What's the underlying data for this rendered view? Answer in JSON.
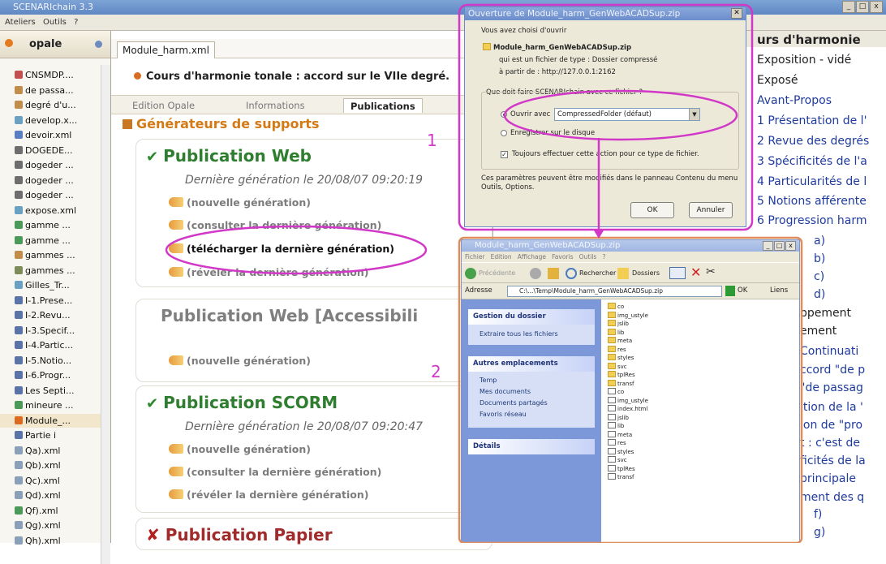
{
  "app": {
    "title": "SCENARIchain 3.3",
    "window_buttons": [
      "_",
      "□",
      "x"
    ]
  },
  "menubar": {
    "items": [
      "Ateliers",
      "Outils",
      "?"
    ]
  },
  "left_panel": {
    "header": "opale",
    "items": [
      {
        "label": "CNSMDP....",
        "color": "#c25050"
      },
      {
        "label": "de passa...",
        "color": "#c28c4a"
      },
      {
        "label": "degré d'u...",
        "color": "#c28c4a"
      },
      {
        "label": "develop.x...",
        "color": "#6aa0c2"
      },
      {
        "label": "devoir.xml",
        "color": "#5a7ec2"
      },
      {
        "label": "DOGEDE...",
        "color": "#6d6d6d"
      },
      {
        "label": "dogeder ...",
        "color": "#6d6d6d"
      },
      {
        "label": "dogeder ...",
        "color": "#6d6d6d"
      },
      {
        "label": "dogeder ...",
        "color": "#6d6d6d"
      },
      {
        "label": "expose.xml",
        "color": "#6aa0c2"
      },
      {
        "label": "gamme ...",
        "color": "#4c9a5a"
      },
      {
        "label": "gamme ...",
        "color": "#4c9a5a"
      },
      {
        "label": "gammes ...",
        "color": "#c28c4a"
      },
      {
        "label": "gammes ...",
        "color": "#7d8c5a"
      },
      {
        "label": "Gilles_Tr...",
        "color": "#6aa0c2"
      },
      {
        "label": "I-1.Prese...",
        "color": "#5a74a8"
      },
      {
        "label": "I-2.Revu...",
        "color": "#5a74a8"
      },
      {
        "label": "I-3.Specif...",
        "color": "#5a74a8"
      },
      {
        "label": "I-4.Partic...",
        "color": "#5a74a8"
      },
      {
        "label": "I-5.Notio...",
        "color": "#5a74a8"
      },
      {
        "label": "I-6.Progr...",
        "color": "#5a74a8"
      },
      {
        "label": "Les Septi...",
        "color": "#5a74a8"
      },
      {
        "label": "mineure ...",
        "color": "#4c9a5a"
      },
      {
        "label": "Module_...",
        "color": "#d96c20",
        "selected": true
      },
      {
        "label": "Partie i",
        "color": "#5a74a8"
      },
      {
        "label": "Qa).xml",
        "color": "#8aa0b8"
      },
      {
        "label": "Qb).xml",
        "color": "#8aa0b8"
      },
      {
        "label": "Qc).xml",
        "color": "#8aa0b8"
      },
      {
        "label": "Qd).xml",
        "color": "#8aa0b8"
      },
      {
        "label": "Qf).xml",
        "color": "#4c9a5a"
      },
      {
        "label": "Qg).xml",
        "color": "#8aa0b8"
      },
      {
        "label": "Qh).xml",
        "color": "#8aa0b8"
      }
    ]
  },
  "main": {
    "file_tab": "Module_harm.xml",
    "doc_title": "Cours d'harmonie tonale : accord sur le VIIe degré.",
    "tabs": [
      "Edition Opale",
      "Informations",
      "Publications"
    ],
    "section_title": "Générateurs de supports",
    "publications": [
      {
        "title": "Publication Web",
        "status": "ok",
        "last_gen": "Dernière génération le 20/08/07 09:20:19",
        "actions": [
          "(nouvelle génération)",
          "(consulter la dernière génération)",
          "(télécharger la dernière génération)",
          "(révéler la dernière génération)"
        ]
      },
      {
        "title": "Publication Web [Accessibili",
        "status": "none",
        "last_gen": "",
        "actions": [
          "(nouvelle génération)"
        ]
      },
      {
        "title": "Publication SCORM",
        "status": "ok",
        "last_gen": "Dernière génération le 20/08/07 09:20:47",
        "actions": [
          "(nouvelle génération)",
          "(consulter la dernière génération)",
          "(révéler la dernière génération)"
        ]
      },
      {
        "title": "Publication Papier",
        "status": "error",
        "last_gen": "",
        "actions": []
      }
    ]
  },
  "right_panel": {
    "lines": [
      {
        "text": "urs d'harmonie",
        "style": "bold"
      },
      {
        "text": "Exposition - vidé",
        "style": "normal"
      },
      {
        "text": "Exposé",
        "style": "normal"
      },
      {
        "text": "Avant-Propos",
        "style": "blue"
      },
      {
        "text": "1 Présentation de l'",
        "style": "blue"
      },
      {
        "text": "2 Revue des degrés",
        "style": "blue"
      },
      {
        "text": "3 Spécificités de l'a",
        "style": "blue"
      },
      {
        "text": "4 Particularités de l",
        "style": "blue"
      },
      {
        "text": "5 Notions afférente",
        "style": "blue"
      },
      {
        "text": "6 Progression harm",
        "style": "blue"
      },
      {
        "text": "a)",
        "style": "blue"
      },
      {
        "text": "b)",
        "style": "blue"
      },
      {
        "text": "c)",
        "style": "blue"
      },
      {
        "text": "d)",
        "style": "blue"
      },
      {
        "text": "ppement",
        "style": "normal"
      },
      {
        "text": "ement",
        "style": "normal"
      },
      {
        "text": "Continuati",
        "style": "blue"
      },
      {
        "text": "ccord \"de p",
        "style": "blue"
      },
      {
        "text": "\"de passag",
        "style": "blue"
      },
      {
        "text": "ition de la '",
        "style": "blue"
      },
      {
        "text": "ion de \"pro",
        "style": "blue"
      },
      {
        "text": "t : c'est de",
        "style": "blue"
      },
      {
        "text": "ficités de la",
        "style": "blue"
      },
      {
        "text": "principale",
        "style": "blue"
      },
      {
        "text": "ment des q",
        "style": "blue"
      },
      {
        "text": "f)",
        "style": "blue"
      },
      {
        "text": "g)",
        "style": "blue"
      }
    ]
  },
  "dialog": {
    "title": "Ouverture de Module_harm_GenWebACADSup.zip",
    "choice_text": "Vous avez choisi d'ouvrir",
    "filename": "Module_harm_GenWebACADSup.zip",
    "filetype": "qui est un fichier de type : Dossier compressé",
    "from": "à partir de : http://127.0.0.1:2162",
    "question": "Que doit faire SCENARIchain avec ce fichier ?",
    "open_with_label": "Ouvrir avec",
    "open_with_value": "CompressedFolder (défaut)",
    "save_label": "Enregistrer sur le disque",
    "always_label": "Toujours effectuer cette action pour ce type de fichier.",
    "note": "Ces paramètres peuvent être modifiés dans le panneau Contenu du menu Outils, Options.",
    "ok": "OK",
    "cancel": "Annuler"
  },
  "explorer": {
    "title": "Module_harm_GenWebACADSup.zip",
    "menu": [
      "Fichier",
      "Edition",
      "Affichage",
      "Favoris",
      "Outils",
      "?"
    ],
    "toolbar": {
      "back": "Précédente",
      "search": "Rechercher",
      "folders": "Dossiers"
    },
    "address_label": "Adresse",
    "address": "C:\\...\\Temp\\Module_harm_GenWebACADSup.zip",
    "go": "OK",
    "links": "Liens",
    "tasks": {
      "title": "Gestion du dossier",
      "items": [
        "Extraire tous les fichiers"
      ]
    },
    "places": {
      "title": "Autres emplacements",
      "items": [
        "Temp",
        "Mes documents",
        "Documents partagés",
        "Favoris réseau"
      ]
    },
    "details": {
      "title": "Détails"
    },
    "files": [
      "co",
      "img_ustyle",
      "jslib",
      "lib",
      "meta",
      "res",
      "styles",
      "svc",
      "tplRes",
      "transf",
      "co",
      "img_ustyle",
      "index.html",
      "jslib",
      "lib",
      "meta",
      "res",
      "styles",
      "svc",
      "tplRes",
      "transf"
    ]
  },
  "annotations": {
    "step1": "1",
    "step2": "2",
    "color": "#d238c8"
  }
}
